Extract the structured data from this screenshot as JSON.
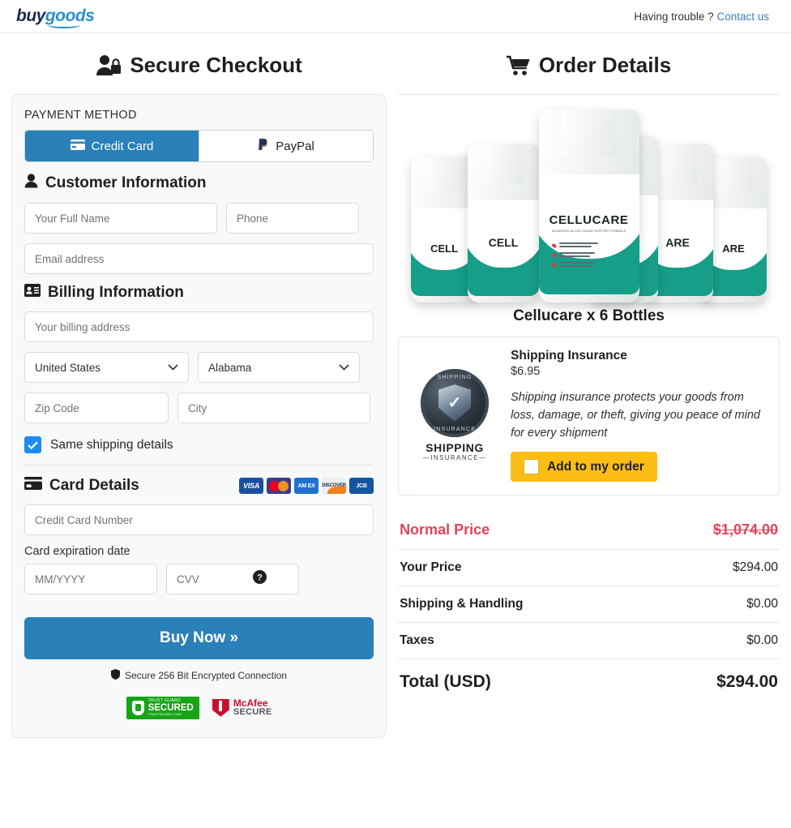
{
  "header": {
    "logo_buy": "buy",
    "logo_goods": "goods",
    "help_text": "Having trouble ?",
    "contact_link": "Contact us"
  },
  "checkout": {
    "heading": "Secure Checkout",
    "payment_method_label": "PAYMENT METHOD",
    "tabs": [
      {
        "label": "Credit Card",
        "icon": "credit-card-icon",
        "active": true
      },
      {
        "label": "PayPal",
        "icon": "paypal-icon",
        "active": false
      }
    ],
    "customer_section": "Customer Information",
    "fields": {
      "full_name": "Your Full Name",
      "phone": "Phone",
      "email": "Email address",
      "billing_address": "Your billing address",
      "country": "United States",
      "state": "Alabama",
      "zip": "Zip Code",
      "city": "City",
      "card_number": "Credit Card Number",
      "expiration": "MM/YYYY",
      "cvv": "CVV"
    },
    "billing_section": "Billing Information",
    "same_shipping": "Same shipping details",
    "card_section": "Card Details",
    "card_brands": [
      "VISA",
      "AM EX",
      "DISCOVER",
      "JCB"
    ],
    "expiration_label": "Card expiration date",
    "buy_button": "Buy Now »",
    "secure_note": "Secure 256 Bit Encrypted Connection",
    "trust_guard": {
      "top": "TRUST GUARD",
      "main": "SECURED",
      "bottom": "TRUSTGUARD.COM"
    },
    "mcafee": {
      "line1": "McAfee",
      "line2": "SECURE"
    }
  },
  "order": {
    "heading": "Order Details",
    "product_name": "Cellucare x 6 Bottles",
    "bottle_brand": "CELLUCARE",
    "bottle_sub": "ADVANCED BLOOD SUGAR SUPPORT FORMULA",
    "bottle_bullets": [
      "SUPPORTS HEALTHY BLOOD SUGAR LEVELS*",
      "PROMOTES BETTER BLOOD CIRCULATION*",
      "SUPPORTS HEALTHY GLUCOSE METABOLISM*"
    ],
    "insurance": {
      "title": "Shipping Insurance",
      "price": "$6.95",
      "description": "Shipping insurance protects your goods from loss, damage, or theft, giving you peace of mind for every shipment",
      "add_label": "Add to my order",
      "logo_line1": "SHIPPING",
      "logo_line2": "—INSURANCE—",
      "seal_top": "SHIPPING",
      "seal_bottom": "INSURANCE"
    },
    "summary": [
      {
        "label": "Normal Price",
        "value": "$1,074.00",
        "style": "normal"
      },
      {
        "label": "Your Price",
        "value": "$294.00",
        "style": "plain"
      },
      {
        "label": "Shipping & Handling",
        "value": "$0.00",
        "style": "plain"
      },
      {
        "label": "Taxes",
        "value": "$0.00",
        "style": "plain"
      },
      {
        "label": "Total (USD)",
        "value": "$294.00",
        "style": "total"
      }
    ]
  },
  "colors": {
    "accent_blue": "#2a80b9",
    "link_blue": "#3a7fc1",
    "checkbox_blue": "#1a8cf0",
    "price_red": "#e0455a",
    "add_yellow": "#fcbe14",
    "bottle_teal": "#179e88"
  }
}
